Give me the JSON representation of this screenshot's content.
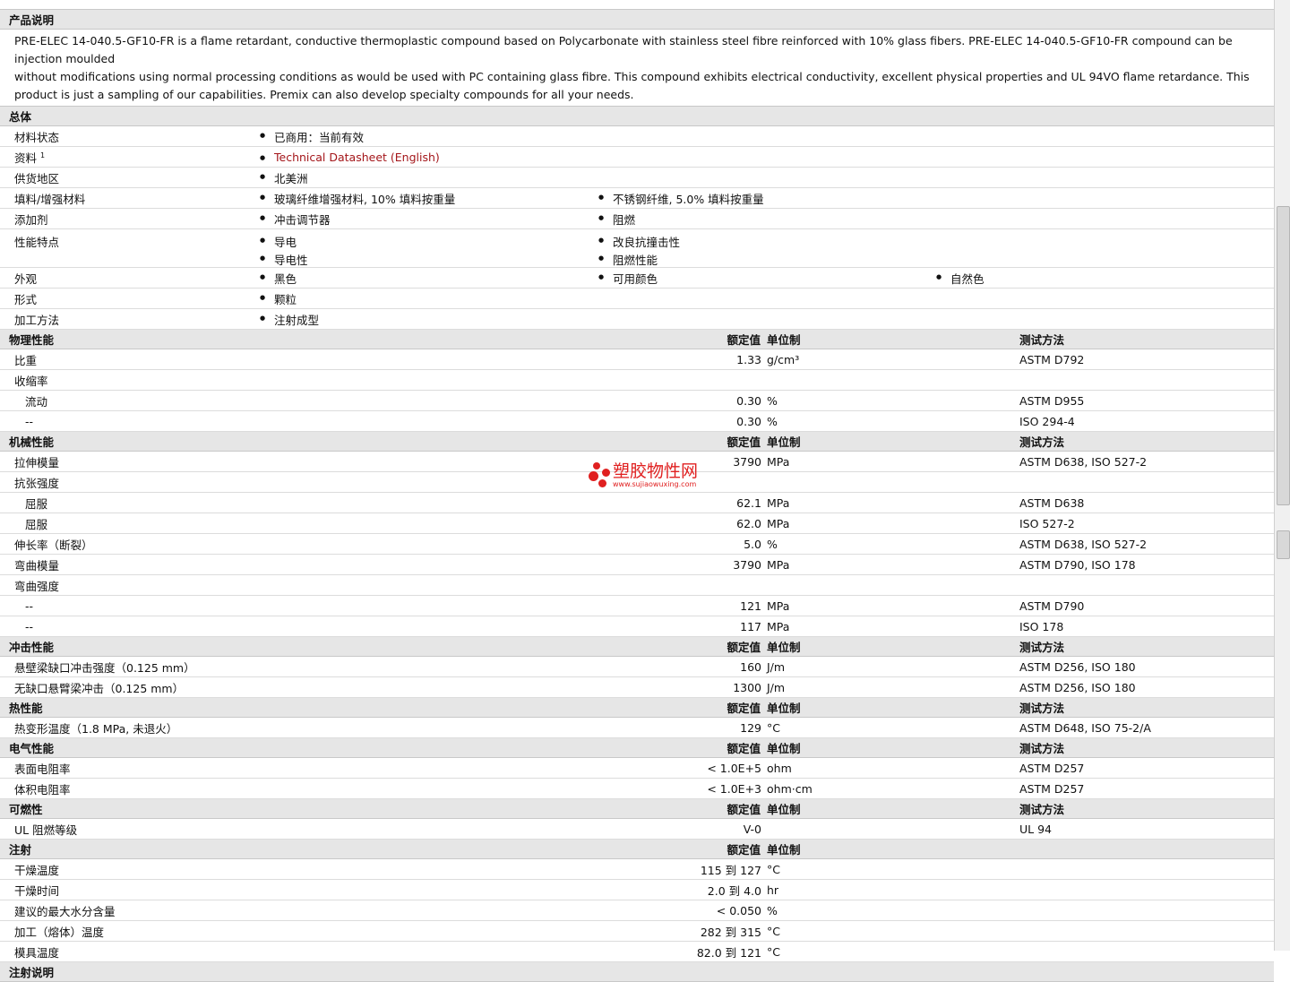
{
  "sections": {
    "product": "产品说明",
    "general": "总体",
    "physical": "物理性能",
    "mechanical": "机械性能",
    "impact": "冲击性能",
    "thermal": "热性能",
    "electrical": "电气性能",
    "flammability": "可燃性",
    "injection": "注射",
    "injection_notes": "注射说明"
  },
  "headers": {
    "value": "额定值",
    "unit": "单位制",
    "test": "测试方法"
  },
  "description": [
    "PRE-ELEC 14-040.5-GF10-FR is a flame retardant, conductive thermoplastic compound based on Polycarbonate with stainless steel fibre reinforced with 10% glass fibers. PRE-ELEC 14-040.5-GF10-FR compound can be injection moulded",
    "without modifications using normal processing conditions as would be used with PC containing glass fibre. This compound exhibits electrical conductivity, excellent physical properties and UL 94VO flame retardance. This",
    "product is just a sampling of our capabilities. Premix can also develop specialty compounds for all your needs."
  ],
  "general": {
    "status_label": "材料状态",
    "status": "已商用：当前有效",
    "docs_label": "资料",
    "docs_sup": "1",
    "docs_link": "Technical Datasheet (English)",
    "region_label": "供货地区",
    "region": "北美洲",
    "filler_label": "填料/增强材料",
    "filler1": "玻璃纤维增强材料, 10% 填料按重量",
    "filler2": "不锈钢纤维, 5.0% 填料按重量",
    "additive_label": "添加剂",
    "additive1": "冲击调节器",
    "additive2": "阻燃",
    "feature_label": "性能特点",
    "feature1": "导电",
    "feature2": "改良抗撞击性",
    "feature3": "导电性",
    "feature4": "阻燃性能",
    "appearance_label": "外观",
    "appearance1": "黑色",
    "appearance2": "可用颜色",
    "appearance3": "自然色",
    "form_label": "形式",
    "form": "颗粒",
    "method_label": "加工方法",
    "method": "注射成型"
  },
  "physical": [
    {
      "label": "比重",
      "value": "1.33",
      "unit": "g/cm³",
      "test": "ASTM D792"
    },
    {
      "label": "收缩率",
      "value": "",
      "unit": "",
      "test": ""
    },
    {
      "label": "流动",
      "value": "0.30",
      "unit": "%",
      "test": "ASTM D955"
    },
    {
      "label": "--",
      "value": "0.30",
      "unit": "%",
      "test": "ISO 294-4"
    }
  ],
  "mechanical": [
    {
      "label": "拉伸模量",
      "value": "3790",
      "unit": "MPa",
      "test": "ASTM D638, ISO 527-2"
    },
    {
      "label": "抗张强度",
      "value": "",
      "unit": "",
      "test": ""
    },
    {
      "label": "屈服",
      "value": "62.1",
      "unit": "MPa",
      "test": "ASTM D638"
    },
    {
      "label": "屈服",
      "value": "62.0",
      "unit": "MPa",
      "test": "ISO 527-2"
    },
    {
      "label": "伸长率（断裂）",
      "value": "5.0",
      "unit": "%",
      "test": "ASTM D638, ISO 527-2"
    },
    {
      "label": "弯曲模量",
      "value": "3790",
      "unit": "MPa",
      "test": "ASTM D790, ISO 178"
    },
    {
      "label": "弯曲强度",
      "value": "",
      "unit": "",
      "test": ""
    },
    {
      "label": "--",
      "value": "121",
      "unit": "MPa",
      "test": "ASTM D790"
    },
    {
      "label": "--",
      "value": "117",
      "unit": "MPa",
      "test": "ISO 178"
    }
  ],
  "impact": [
    {
      "label": "悬壁梁缺口冲击强度（0.125 mm）",
      "value": "160",
      "unit": "J/m",
      "test": "ASTM D256, ISO 180"
    },
    {
      "label": "无缺口悬臂梁冲击（0.125 mm）",
      "value": "1300",
      "unit": "J/m",
      "test": "ASTM D256, ISO 180"
    }
  ],
  "thermal": [
    {
      "label": "热变形温度（1.8 MPa, 未退火）",
      "value": "129",
      "unit": "°C",
      "test": "ASTM D648, ISO 75-2/A"
    }
  ],
  "electrical": [
    {
      "label": "表面电阻率",
      "value": "< 1.0E+5",
      "unit": "ohm",
      "test": "ASTM D257"
    },
    {
      "label": "体积电阻率",
      "value": "< 1.0E+3",
      "unit": "ohm·cm",
      "test": "ASTM D257"
    }
  ],
  "flammability": [
    {
      "label": "UL 阻燃等级",
      "value": "V-0",
      "unit": "",
      "test": "UL 94"
    }
  ],
  "injection": [
    {
      "label": "干燥温度",
      "value": "115 到  127",
      "unit": "°C"
    },
    {
      "label": "干燥时间",
      "value": "2.0 到  4.0",
      "unit": "hr"
    },
    {
      "label": "建议的最大水分含量",
      "value": "< 0.050",
      "unit": "%"
    },
    {
      "label": "加工（熔体）温度",
      "value": "282 到  315",
      "unit": "°C"
    },
    {
      "label": "模具温度",
      "value": "82.0 到  121",
      "unit": "°C"
    }
  ],
  "watermark": {
    "name": "塑胶物性网",
    "url": "www.sujiaowuxing.com"
  }
}
